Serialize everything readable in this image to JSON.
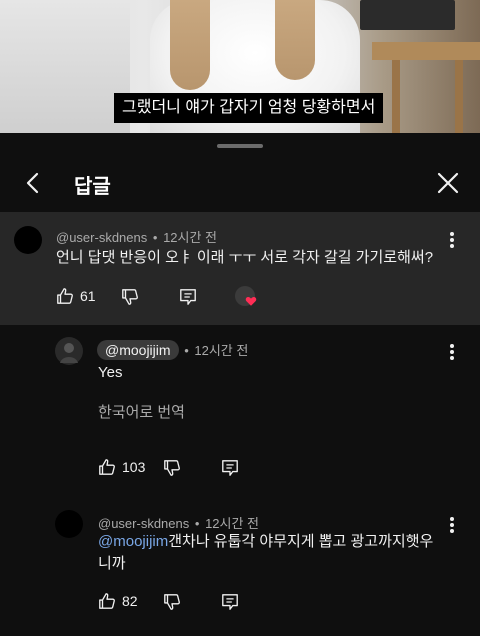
{
  "video": {
    "subtitle": "그랬더니 얘가 갑자기 엄청 당황하면서"
  },
  "header": {
    "title": "답글"
  },
  "parent_comment": {
    "author": "@user-skdnens",
    "time": "12시간 전",
    "text": "언니 답댓 반응이 오ㅑ 이래 ㅜㅜ  서로 각자 갈길 가기로해써?",
    "likes": "61"
  },
  "replies": [
    {
      "author": "@moojijim",
      "time": "12시간 전",
      "text": "Yes",
      "translate": "한국어로 번역",
      "likes": "103"
    },
    {
      "author": "@user-skdnens",
      "time": "12시간 전",
      "mention": "@moojijim",
      "text": "갠차나 유툽각 야무지게 뽑고 광고까지햇우",
      "text2": "니까",
      "likes": "82"
    }
  ],
  "sep": "•",
  "colors": {
    "background": "#0f0f0f",
    "highlight": "#272727",
    "mention": "#7aa7e6",
    "heart": "#ff2d55"
  }
}
